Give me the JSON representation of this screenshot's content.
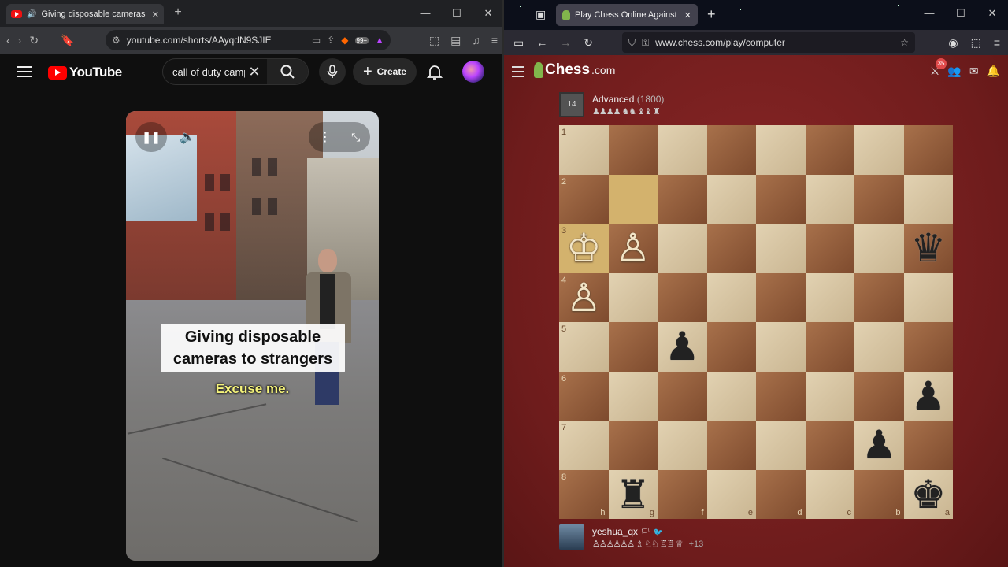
{
  "left_browser": {
    "tab_title": "Giving disposable cameras to strangers",
    "url": "youtube.com/shorts/AAyqdN9SJIE",
    "extension_badge": "99+",
    "youtube": {
      "logo": "YouTube",
      "search_query": "call of duty camp",
      "create_label": "Create",
      "short": {
        "caption_lines": [
          "Giving disposable",
          "cameras to strangers"
        ],
        "subtitle": "Excuse me."
      }
    }
  },
  "right_browser": {
    "tab_title": "Play Chess Online Against the Computer",
    "url": "www.chess.com/play/computer",
    "chess": {
      "logo": "Chess",
      "logo_suffix": ".com",
      "notifications": "35",
      "opponent": {
        "avatar_label": "14",
        "name": "Advanced",
        "rating": "(1800)",
        "captured": "♟♟♟♟ ♞♞ ♝♝ ♜"
      },
      "player": {
        "name": "yeshua_qx",
        "captured": "♙♙♙♙♙♙ ♗ ♘♘ ♖♖ ♕",
        "advantage": "+13"
      },
      "ranks": [
        "1",
        "2",
        "3",
        "4",
        "5",
        "6",
        "7",
        "8"
      ],
      "files": [
        "h",
        "g",
        "f",
        "e",
        "d",
        "c",
        "b",
        "a"
      ],
      "pieces": [
        {
          "square": "h3",
          "piece": "♔",
          "color": "white"
        },
        {
          "square": "g3",
          "piece": "♙",
          "color": "white"
        },
        {
          "square": "h4",
          "piece": "♙",
          "color": "white"
        },
        {
          "square": "a3",
          "piece": "♛",
          "color": "black"
        },
        {
          "square": "f5",
          "piece": "♟",
          "color": "black"
        },
        {
          "square": "a6",
          "piece": "♟",
          "color": "black"
        },
        {
          "square": "b7",
          "piece": "♟",
          "color": "black"
        },
        {
          "square": "g8",
          "piece": "♜",
          "color": "black"
        },
        {
          "square": "a8",
          "piece": "♚",
          "color": "black"
        }
      ],
      "highlighted_squares": [
        "g2",
        "h3"
      ]
    }
  },
  "colors": {
    "youtube_red": "#ff0000",
    "chess_green": "#81b64c",
    "board_light": "#e2d2b2",
    "board_dark": "#a8714b",
    "highlight": "#d3b26d"
  }
}
